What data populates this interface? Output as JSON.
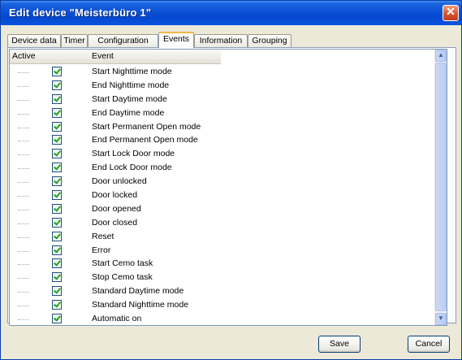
{
  "window": {
    "title": "Edit device \"Meisterbüro 1\""
  },
  "tabs": [
    "Device data",
    "Timer",
    "Configuration",
    "Events",
    "Information",
    "Grouping"
  ],
  "active_tab": "Events",
  "list": {
    "columns": {
      "active": "Active",
      "event": "Event"
    },
    "events": [
      {
        "label": "Start Nighttime mode",
        "checked": true
      },
      {
        "label": "End Nighttime mode",
        "checked": true
      },
      {
        "label": "Start Daytime mode",
        "checked": true
      },
      {
        "label": "End Daytime mode",
        "checked": true
      },
      {
        "label": "Start Permanent Open mode",
        "checked": true
      },
      {
        "label": "End Permanent Open mode",
        "checked": true
      },
      {
        "label": "Start Lock Door mode",
        "checked": true
      },
      {
        "label": "End Lock Door mode",
        "checked": true
      },
      {
        "label": "Door unlocked",
        "checked": true
      },
      {
        "label": "Door locked",
        "checked": true
      },
      {
        "label": "Door opened",
        "checked": true
      },
      {
        "label": "Door closed",
        "checked": true
      },
      {
        "label": "Reset",
        "checked": true
      },
      {
        "label": "Error",
        "checked": true
      },
      {
        "label": "Start Cemo task",
        "checked": true
      },
      {
        "label": "Stop Cemo task",
        "checked": true
      },
      {
        "label": "Standard Daytime mode",
        "checked": true
      },
      {
        "label": "Standard Nighttime mode",
        "checked": true
      },
      {
        "label": "Automatic on",
        "checked": true
      }
    ]
  },
  "buttons": {
    "save": "Save",
    "cancel": "Cancel"
  },
  "icons": {
    "close": "close-icon",
    "checkbox": "checkmark-icon",
    "scroll_up": "arrow-up-icon",
    "scroll_down": "arrow-down-icon"
  },
  "colors": {
    "titlebar": "#0a52d8",
    "active_tab_accent": "#f5b64a",
    "check": "#21a121"
  }
}
